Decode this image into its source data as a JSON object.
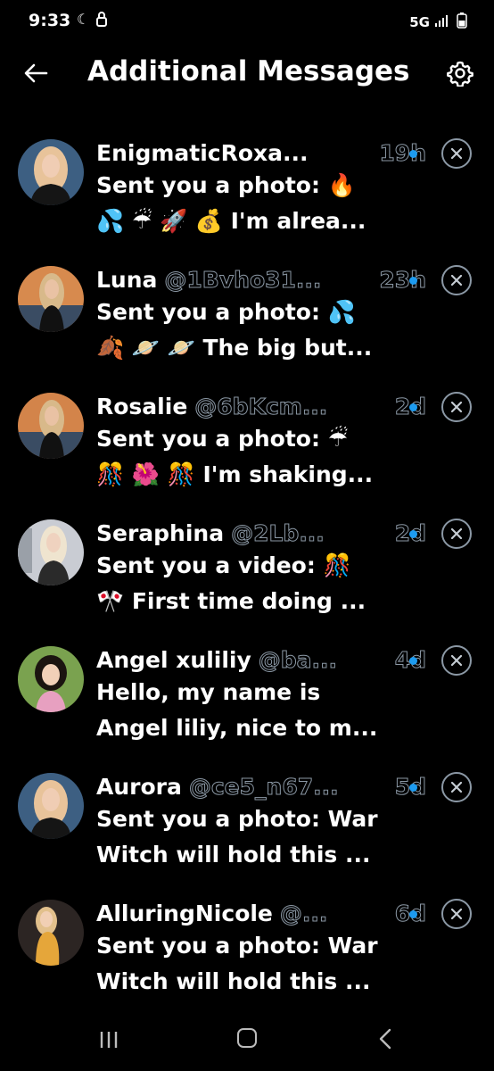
{
  "status_bar": {
    "time": "9:33",
    "network": "5G"
  },
  "header": {
    "title": "Additional Messages"
  },
  "messages": [
    {
      "name": "EnigmaticRoxa...",
      "handle": "",
      "time": "19h",
      "line1": "Sent you a photo: 🔥",
      "line2": "💦 ☔ 🚀 💰 I'm alrea...",
      "avatar_bg": "#3d5f82",
      "avatar_hair": "#e8c39a",
      "avatar_shirt": "#151515"
    },
    {
      "name": "Luna",
      "handle": "@1Bvho31...",
      "time": "23h",
      "line1": "Sent you a photo: 💦",
      "line2": "🍂 🪐 🪐 The big but...",
      "avatar_bg": "#d78a4e",
      "avatar_hair": "#d8b98a",
      "avatar_shirt": "#111111"
    },
    {
      "name": "Rosalie",
      "handle": "@6bKcm...",
      "time": "2d",
      "line1": "Sent you a photo: ☔",
      "line2": "🎊 🌺 🎊 I'm shaking...",
      "avatar_bg": "#d3844a",
      "avatar_hair": "#d8b98a",
      "avatar_shirt": "#111111"
    },
    {
      "name": "Seraphina",
      "handle": "@2Lb...",
      "time": "2d",
      "line1": "Sent you a video: 🎊",
      "line2": "🎌 First time doing ...",
      "avatar_bg": "#c9ccd3",
      "avatar_hair": "#efe4cf",
      "avatar_shirt": "#2a2a2a"
    },
    {
      "name": "Angel xuliliy",
      "handle": "@ba...",
      "time": "4d",
      "line1": "Hello, my name is",
      "line2": "Angel liliy, nice to m...",
      "avatar_bg": "#7aa24f",
      "avatar_hair": "#1b1410",
      "avatar_shirt": "#e7a0c0"
    },
    {
      "name": "Aurora",
      "handle": "@ce5_n67...",
      "time": "5d",
      "line1": "Sent you a photo: War",
      "line2": "Witch will hold this ...",
      "avatar_bg": "#3d5f82",
      "avatar_hair": "#e8c39a",
      "avatar_shirt": "#151515"
    },
    {
      "name": "AlluringNicole",
      "handle": "@...",
      "time": "6d",
      "line1": "Sent you a photo: War",
      "line2": "Witch will hold this ...",
      "avatar_bg": "#2c2523",
      "avatar_hair": "#e2c08c",
      "avatar_shirt": "#e5a63a"
    }
  ],
  "colors": {
    "background": "#000000",
    "text": "#ffffff",
    "secondary_text": "#8b98a5",
    "unread_dot": "#1d9bf0"
  }
}
